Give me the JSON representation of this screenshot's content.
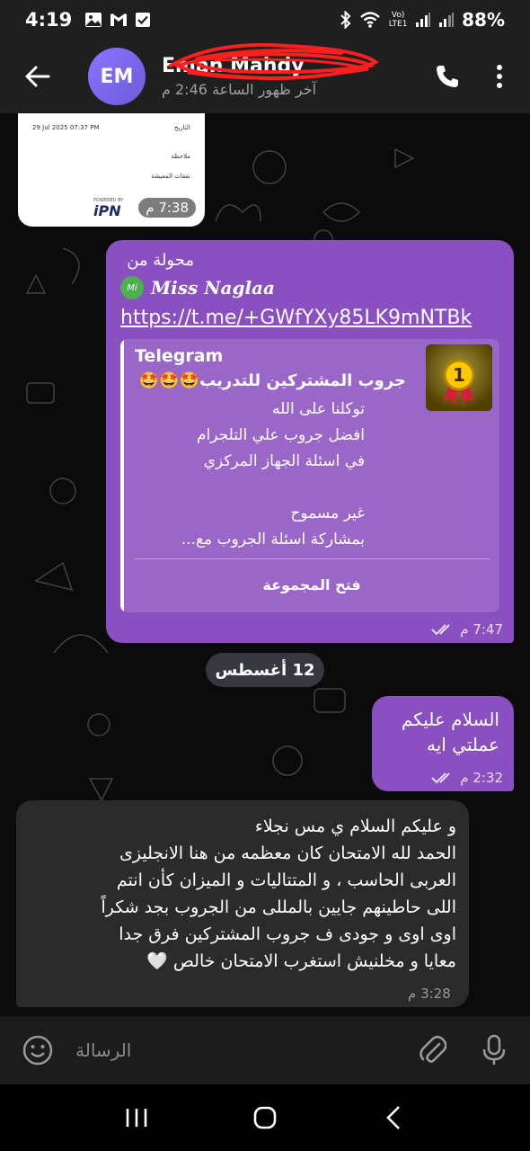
{
  "status_bar": {
    "time": "4:19",
    "battery": "88%",
    "carrier_label": "Vo) LTE1"
  },
  "header": {
    "avatar_initials": "EM",
    "contact_name": "Eman Mahdy",
    "last_seen": "آخر ظهور الساعة 2:46 م"
  },
  "image_message": {
    "doc_date": "29 Jul 2025 07:37 PM",
    "doc_label_1": "التاريخ",
    "doc_label_2": "ملاحظة",
    "doc_label_3": "نفقات المعيشة",
    "brand": "iPN",
    "brand_caption": "POWERED BY",
    "time": "7:38 م"
  },
  "forwarded_message": {
    "forwarded_label": "محولة من",
    "from_avatar": "Mi",
    "from_name": "Miss Naglaa",
    "link": "https://t.me/+GWfYXy85LK9mNTBk",
    "preview": {
      "site": "Telegram",
      "title": "جروب المشتركين للتدريب🤩🤩🤩",
      "desc": [
        "توكلنا على الله",
        "افضل جروب علي التلجرام",
        "في اسئلة الجهاز المركزي",
        "",
        "غير مسموح",
        "بمشاركة اسئلة  الجروب مع..."
      ],
      "button": "فتح المجموعة"
    },
    "time": "7:47 م"
  },
  "date_separator": "12 أغسطس",
  "short_message": {
    "lines": [
      "السلام عليكم",
      "عملتي ايه"
    ],
    "time": "2:32 م"
  },
  "incoming_message": {
    "lines": [
      "و عليكم السلام ي مس نجلاء",
      "الحمد لله الامتحان كان معظمه من هنا الانجليزى",
      "العربى الحاسب ، و المتتاليات و الميزان كأن انتم",
      "اللى حاطينهم جايين بالمللى من الجروب بجد شكراً",
      "اوى اوى و جودى ف جروب المشتركين فرق جدا",
      "معايا و مخلنيش استغرب الامتحان خالص 🤍"
    ],
    "time": "3:28 م"
  },
  "input": {
    "placeholder": "الرسالة"
  },
  "colors": {
    "outgoing_bubble": "#8a4fc0",
    "incoming_bubble": "#2b2b2b",
    "avatar": "#7b68ee"
  }
}
